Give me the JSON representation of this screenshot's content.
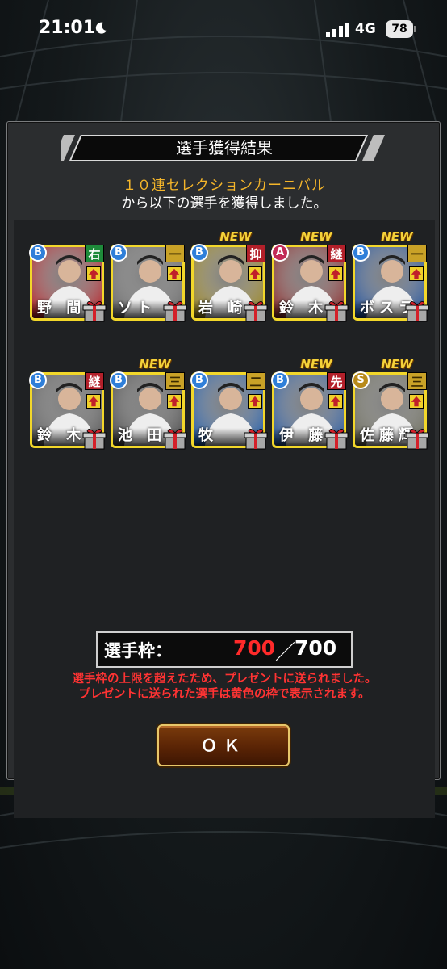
{
  "status_bar": {
    "time": "21:01",
    "network": "4G",
    "battery": "78"
  },
  "dialog": {
    "title": "選手獲得結果",
    "subtitle_line1": "１０連セレクションカーニバル",
    "subtitle_line2": "から以下の選手を獲得しました。",
    "players": [
      {
        "name": "野 間",
        "rank": "B",
        "position": "右",
        "is_new": false,
        "rank_color": "#2f7fd9",
        "pos_color": "#1e8a3a",
        "bg": "#b3242a"
      },
      {
        "name": "ソト",
        "rank": "B",
        "position": "一",
        "is_new": false,
        "rank_color": "#2f7fd9",
        "pos_color": "#c9a227",
        "bg": "#6a6a6a"
      },
      {
        "name": "岩 崎",
        "rank": "B",
        "position": "抑",
        "is_new": true,
        "rank_color": "#2f7fd9",
        "pos_color": "#b3202a",
        "bg": "#9a8420"
      },
      {
        "name": "鈴 木",
        "rank": "A",
        "position": "継",
        "is_new": true,
        "rank_color": "#c22a56",
        "pos_color": "#b3202a",
        "bg": "#8a2a2a"
      },
      {
        "name": "ボスラ",
        "rank": "B",
        "position": "一",
        "is_new": true,
        "rank_color": "#2f7fd9",
        "pos_color": "#c9a227",
        "bg": "#1f4f9a"
      },
      {
        "name": "鈴 木",
        "rank": "B",
        "position": "継",
        "is_new": false,
        "rank_color": "#2f7fd9",
        "pos_color": "#b3202a",
        "bg": "#5a5a5a"
      },
      {
        "name": "池 田",
        "rank": "B",
        "position": "三",
        "is_new": true,
        "rank_color": "#2f7fd9",
        "pos_color": "#c9a227",
        "bg": "#4a4a4a"
      },
      {
        "name": "牧",
        "rank": "B",
        "position": "二",
        "is_new": false,
        "rank_color": "#2f7fd9",
        "pos_color": "#c9a227",
        "bg": "#1f5aa8"
      },
      {
        "name": "伊 藤",
        "rank": "B",
        "position": "先",
        "is_new": true,
        "rank_color": "#2f7fd9",
        "pos_color": "#b3202a",
        "bg": "#2a5aa0"
      },
      {
        "name": "佐藤輝",
        "rank": "S",
        "position": "三",
        "is_new": true,
        "rank_color": "#b88a1a",
        "pos_color": "#c9a227",
        "bg": "#6a6a5a"
      }
    ],
    "new_label": "NEW",
    "slots": {
      "label": "選手枠：",
      "current": "700",
      "separator": "／",
      "max": "700"
    },
    "notice_line1": "選手枠の上限を超えたため、プレゼントに送られました。",
    "notice_line2": "プレゼントに送られた選手は黄色の枠で表示されます。",
    "ok_label": "ＯＫ"
  }
}
